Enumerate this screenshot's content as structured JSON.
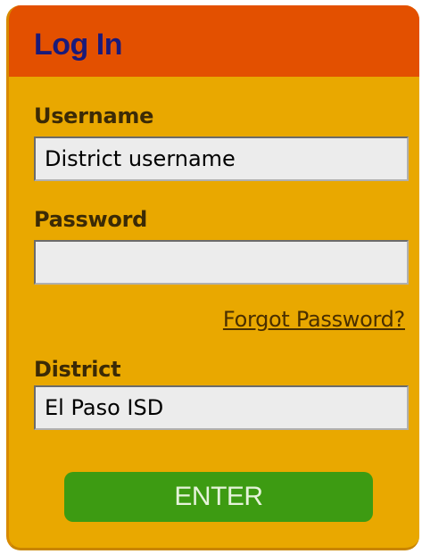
{
  "header": {
    "title": "Log In"
  },
  "form": {
    "username_label": "Username",
    "username_value": "District username",
    "password_label": "Password",
    "password_value": "",
    "forgot_password_label": "Forgot Password?",
    "district_label": "District",
    "district_value": "El Paso ISD",
    "enter_label": "ENTER"
  },
  "colors": {
    "panel_background": "#e9a800",
    "header_background": "#e35000",
    "title_text": "#1a1a7a",
    "enter_button": "#3d9b12"
  }
}
